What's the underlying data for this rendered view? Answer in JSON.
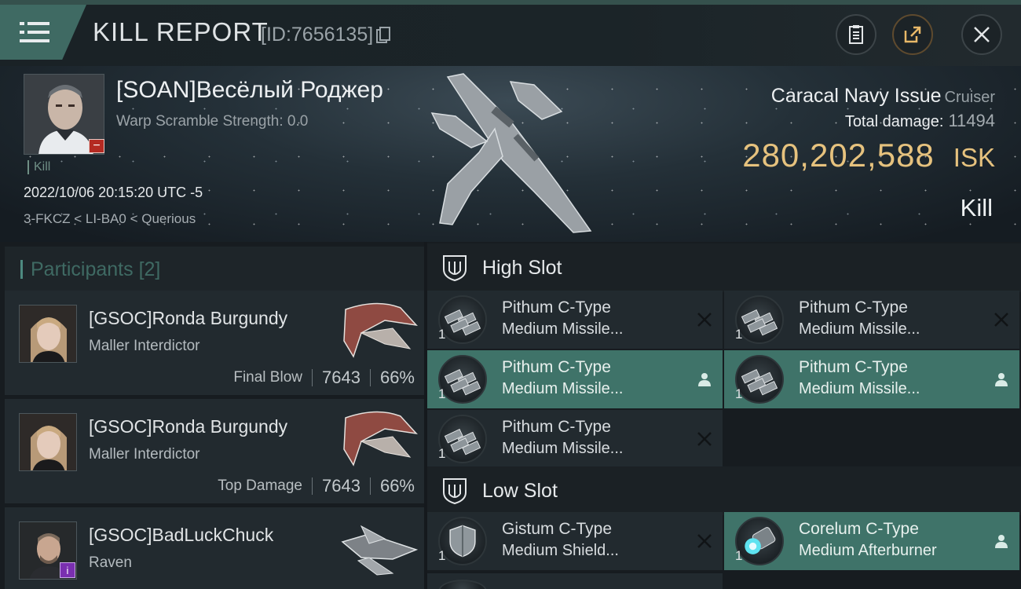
{
  "header": {
    "title": "KILL REPORT",
    "id_text": "[ID:7656135]"
  },
  "victim": {
    "name": "[SOAN]Весёлый Роджер",
    "warp_scramble": "Warp Scramble Strength: 0.0",
    "kill_tag": "Kill",
    "datetime": "2022/10/06 20:15:20 UTC -5",
    "location": "3-FKCZ < LI-BA0 < Querious",
    "ship_name": "Caracal Navy Issue",
    "ship_class": "Cruiser",
    "total_damage_label": "Total damage:",
    "total_damage": "11494",
    "isk_value": "280,202,588",
    "isk_unit": "ISK",
    "result": "Kill"
  },
  "participants": {
    "label": "Participants",
    "count": "[2]",
    "items": [
      {
        "name": "[GSOC]Ronda Burgundy",
        "ship": "Maller Interdictor",
        "role": "Final Blow",
        "damage": "7643",
        "percent": "66%"
      },
      {
        "name": "[GSOC]Ronda Burgundy",
        "ship": "Maller Interdictor",
        "role": "Top Damage",
        "damage": "7643",
        "percent": "66%"
      },
      {
        "name": "[GSOC]BadLuckChuck",
        "ship": "Raven",
        "info_badge": "i"
      }
    ]
  },
  "slots": {
    "high_label": "High Slot",
    "low_label": "Low Slot",
    "high": [
      {
        "line1": "Pithum C-Type",
        "line2": "Medium Missile...",
        "qty": "1",
        "state": "destroyed"
      },
      {
        "line1": "Pithum C-Type",
        "line2": "Medium Missile...",
        "qty": "1",
        "state": "destroyed"
      },
      {
        "line1": "Pithum C-Type",
        "line2": "Medium Missile...",
        "qty": "1",
        "state": "dropped"
      },
      {
        "line1": "Pithum C-Type",
        "line2": "Medium Missile...",
        "qty": "1",
        "state": "dropped"
      },
      {
        "line1": "Pithum C-Type",
        "line2": "Medium Missile...",
        "qty": "1",
        "state": "destroyed"
      }
    ],
    "low": [
      {
        "line1": "Gistum C-Type",
        "line2": "Medium Shield...",
        "qty": "1",
        "state": "destroyed"
      },
      {
        "line1": "Corelum C-Type",
        "line2": "Medium Afterburner",
        "qty": "1",
        "state": "dropped"
      }
    ]
  },
  "colors": {
    "accent": "#3f6a63",
    "isk": "#e6c27e",
    "dropped_bg": "#3f7369",
    "danger": "#b42a22"
  }
}
